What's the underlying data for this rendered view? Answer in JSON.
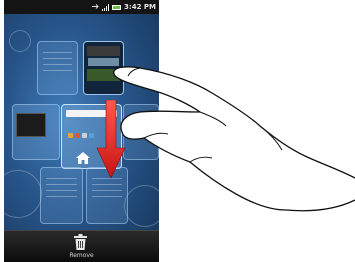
{
  "status_bar": {
    "time": "3:42 PM",
    "icons": [
      "usb-icon",
      "signal-icon",
      "battery-icon"
    ]
  },
  "panels": [
    {
      "id": "row1-col1",
      "content": "empty"
    },
    {
      "id": "row1-col2",
      "content": "widget"
    },
    {
      "id": "row2-col1",
      "content": "widget"
    },
    {
      "id": "row2-col2",
      "content": "home-screen",
      "selected": true
    },
    {
      "id": "row2-col3",
      "content": "empty"
    },
    {
      "id": "row3-col1",
      "content": "empty"
    },
    {
      "id": "row3-col2",
      "content": "empty"
    }
  ],
  "remove_bar": {
    "icon": "trash-icon",
    "label": "Remove"
  },
  "gesture": {
    "icon": "swipe-down-arrow-icon",
    "illustration": "pointing-hand-icon"
  },
  "colors": {
    "arrow": "#e02020",
    "screen_background": "#27558a",
    "status_bar": "#141414"
  }
}
